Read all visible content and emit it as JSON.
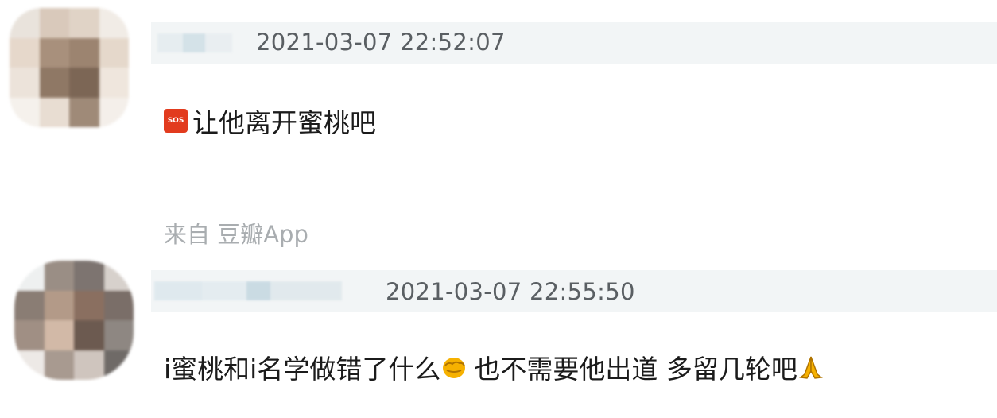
{
  "comments": [
    {
      "timestamp": "2021-03-07 22:52:07",
      "icon": "sos-icon",
      "icon_text": "SOS",
      "text": "让他离开蜜桃吧"
    },
    {
      "timestamp": "2021-03-07 22:55:50",
      "text_part1": "i蜜桃和i名学做错了什么",
      "icon_mid": "fist-icon",
      "text_part2": "也不需要他出道 多留几轮吧",
      "icon_end": "pray-icon"
    }
  ],
  "source": "来自 豆瓣App",
  "colors": {
    "header_bg": "#f2f5f6",
    "timestamp": "#5a5f63",
    "body_text": "#1b1b1b",
    "source_text": "#a9adb0",
    "sos_red": "#e23b1e"
  }
}
